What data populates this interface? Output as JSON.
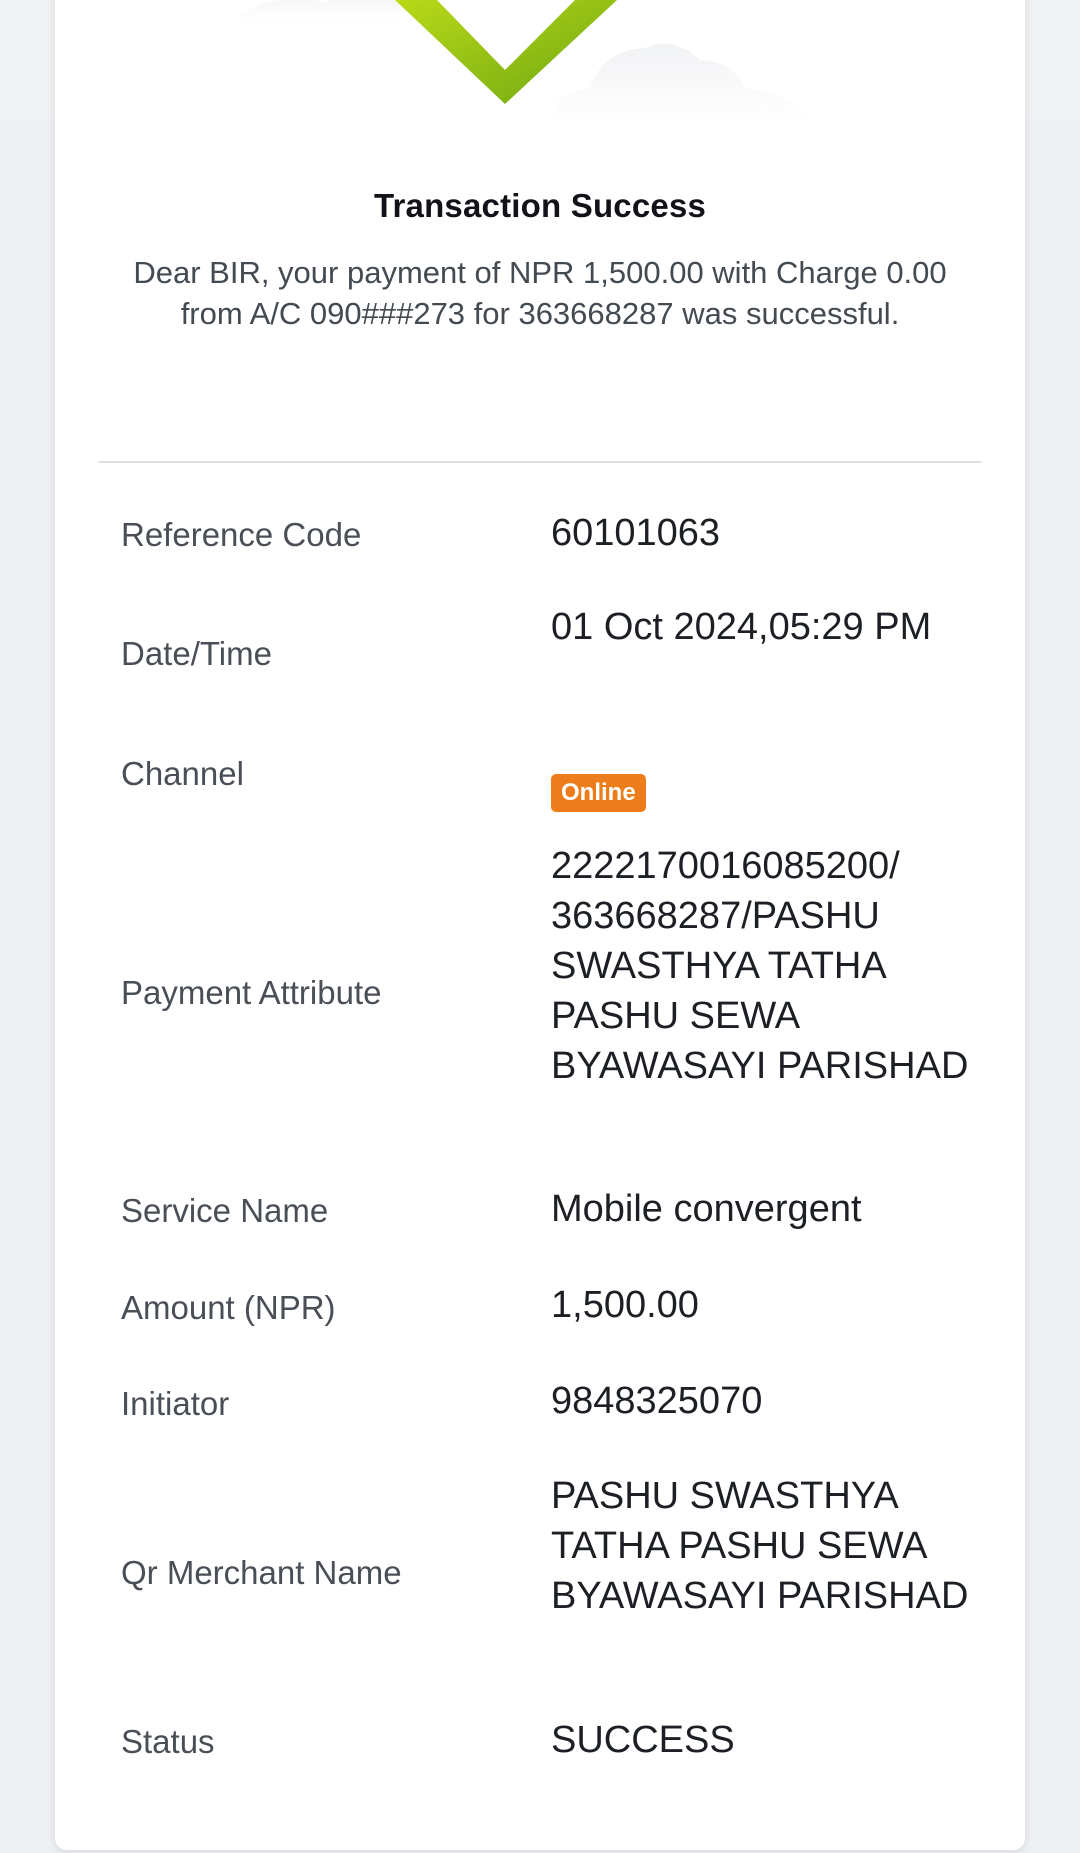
{
  "header": {
    "title": "Transaction Success",
    "message": "Dear BIR, your payment of NPR 1,500.00 with Charge 0.00 from A/C 090###273 for 363668287 was successful."
  },
  "details": {
    "reference_code": {
      "label": "Reference Code",
      "value": "60101063"
    },
    "date_time": {
      "label": "Date/Time",
      "value": "01 Oct 2024,05:29 PM"
    },
    "channel": {
      "label": "Channel",
      "value": "Online"
    },
    "payment_attribute": {
      "label": "Payment Attribute",
      "value": "2222170016085200/ 363668287/PASHU SWASTHYA TATHA PASHU SEWA BYAWASAYI PARISHAD"
    },
    "service_name": {
      "label": "Service Name",
      "value": "Mobile convergent"
    },
    "amount": {
      "label": "Amount (NPR)",
      "value": "1,500.00"
    },
    "initiator": {
      "label": "Initiator",
      "value": "9848325070"
    },
    "qr_merchant_name": {
      "label": "Qr Merchant Name",
      "value": "PASHU SWASTHYA TATHA PASHU SEWA BYAWASAYI PARISHAD"
    },
    "status": {
      "label": "Status",
      "value": "SUCCESS"
    }
  },
  "colors": {
    "success_green": "#8cc11a",
    "channel_badge": "#ec7d1a"
  },
  "icons": {
    "success": "checkmark-icon",
    "decoration": "cloud-icon"
  }
}
